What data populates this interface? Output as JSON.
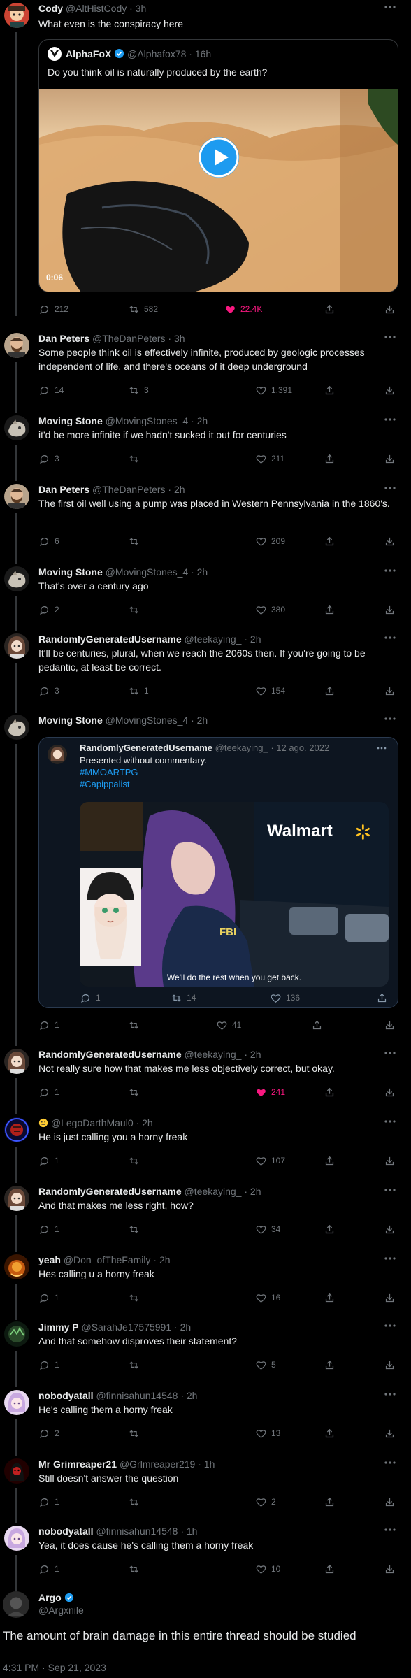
{
  "posts": {
    "p1": {
      "name": "Cody",
      "handle": "@AltHistCody",
      "time": "3h",
      "text": "What even is the conspiracy here"
    },
    "quote1": {
      "name": "AlphaFoX",
      "handle": "@Alphafox78",
      "time": "16h",
      "text": "Do you think oil is naturally produced by the earth?",
      "video_time": "0:06"
    },
    "p1_stats": {
      "replies": "212",
      "reposts": "582",
      "likes": "22.4K"
    },
    "p2": {
      "name": "Dan Peters",
      "handle": "@TheDanPeters",
      "time": "3h",
      "text": "Some people think oil is effectively infinite, produced by geologic processes independent of life, and there's oceans of it deep underground",
      "replies": "14",
      "reposts": "3",
      "likes": "1,391"
    },
    "p3": {
      "name": "Moving Stone",
      "handle": "@MovingStones_4",
      "time": "2h",
      "text": "it'd be more infinite if we hadn't sucked it out for centuries",
      "replies": "3",
      "reposts": "",
      "likes": "211"
    },
    "p4": {
      "name": "Dan Peters",
      "handle": "@TheDanPeters",
      "time": "2h",
      "text": "The first oil well using a pump was placed in Western Pennsylvania in the 1860's.",
      "replies": "6",
      "reposts": "",
      "likes": "209"
    },
    "p5": {
      "name": "Moving Stone",
      "handle": "@MovingStones_4",
      "time": "2h",
      "text": "That's over a century ago",
      "replies": "2",
      "reposts": "",
      "likes": "380"
    },
    "p6": {
      "name": "RandomlyGeneratedUsername",
      "handle": "@teekaying_",
      "time": "2h",
      "text": "It'll be centuries, plural, when we reach the 2060s then. If you're going to be pedantic, at least be correct.",
      "replies": "3",
      "reposts": "1",
      "likes": "154"
    },
    "p7": {
      "name": "Moving Stone",
      "handle": "@MovingStones_4",
      "time": "2h",
      "replies": "1",
      "reposts": "",
      "likes": "41"
    },
    "quote2": {
      "name": "RandomlyGeneratedUsername",
      "handle": "@teekaying_",
      "time": "12 ago. 2022",
      "text": "Presented without commentary.",
      "tag1": "#MMOARTPG",
      "tag2": "#Capippalist",
      "img_sign": "Walmart",
      "img_badge": "FBI",
      "img_caption": "We'll do the rest when you get back.",
      "replies": "1",
      "reposts": "14",
      "likes": "136"
    },
    "p8": {
      "name": "RandomlyGeneratedUsername",
      "handle": "@teekaying_",
      "time": "2h",
      "text": "Not really sure how that makes me less objectively correct, but okay.",
      "replies": "1",
      "reposts": "",
      "likes": "241"
    },
    "p9": {
      "name": "",
      "handle": "@LegoDarthMaul0",
      "time": "2h",
      "text": "He is just calling you a horny freak",
      "replies": "1",
      "reposts": "",
      "likes": "107"
    },
    "p10": {
      "name": "RandomlyGeneratedUsername",
      "handle": "@teekaying_",
      "time": "2h",
      "text": "And that makes me less right, how?",
      "replies": "1",
      "reposts": "",
      "likes": "34"
    },
    "p11": {
      "name": "yeah",
      "handle": "@Don_ofTheFamily",
      "time": "2h",
      "text": "Hes calling u a horny freak",
      "replies": "1",
      "reposts": "",
      "likes": "16"
    },
    "p12": {
      "name": "Jimmy P",
      "handle": "@SarahJe17575991",
      "time": "2h",
      "text": "And that somehow disproves their statement?",
      "replies": "1",
      "reposts": "",
      "likes": "5"
    },
    "p13": {
      "name": "nobodyatall",
      "handle": "@finnisahun14548",
      "time": "2h",
      "text": "He's calling them a horny freak",
      "replies": "2",
      "reposts": "",
      "likes": "13"
    },
    "p14": {
      "name": "Mr Grimreaper21",
      "handle": "@Grlmreaper219",
      "time": "1h",
      "text": "Still doesn't answer the question",
      "replies": "1",
      "reposts": "",
      "likes": "2"
    },
    "p15": {
      "name": "nobodyatall",
      "handle": "@finnisahun14548",
      "time": "1h",
      "text": "Yea, it does cause he's calling them a horny freak",
      "replies": "1",
      "reposts": "",
      "likes": "10"
    }
  },
  "final": {
    "name": "Argo",
    "handle": "@Argxnile",
    "text": "The amount of brain damage in this entire thread should be studied",
    "timestamp": "4:31 PM · Sep 21, 2023"
  },
  "icons": [
    "reply-icon",
    "repost-icon",
    "like-icon",
    "views-icon",
    "share-icon",
    "more-icon",
    "verified-icon",
    "play-icon"
  ],
  "colors": {
    "bg": "#000000",
    "text": "#e7e9ea",
    "muted": "#71767b",
    "like": "#f91880",
    "link": "#1d9bf0"
  }
}
